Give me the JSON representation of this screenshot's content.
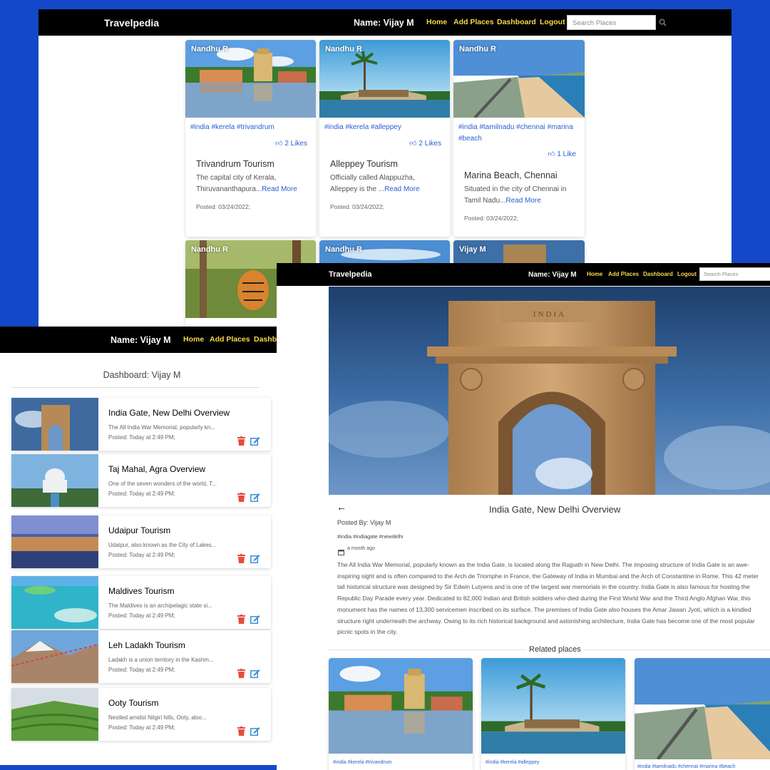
{
  "colors": {
    "background": "#1448c8",
    "navbar": "#000000",
    "nav_link": "#f5d84b",
    "link": "#2a5fd0",
    "delete": "#e74c3c",
    "edit": "#3a8fd9"
  },
  "nav": {
    "brand": "Travelpedia",
    "user": "Name: Vijay M",
    "links": [
      "Home",
      "Add Places",
      "Dashboard",
      "Logout"
    ],
    "search_placeholder": "Search Places",
    "search_icon": "search-icon"
  },
  "feed": {
    "cards": [
      {
        "author": "Nandhu R",
        "tags": "#india #kerela #trivandrum",
        "likes": "2 Likes",
        "title": "Trivandrum Tourism",
        "desc": "The capital city of Kerala, Thiruvananthapura...",
        "read_more": "Read More",
        "posted": "Posted: 03/24/2022;"
      },
      {
        "author": "Nandhu R",
        "tags": "#india #kerela #alleppey",
        "likes": "2 Likes",
        "title": "Alleppey Tourism",
        "desc": "Officially called Alappuzha, Alleppey is the ...",
        "read_more": "Read More",
        "posted": "Posted: 03/24/2022;"
      },
      {
        "author": "Nandhu R",
        "tags": "#india #tamilnadu #chennai #marina #beach",
        "likes": "1 Like",
        "title": "Marina Beach, Chennai",
        "desc": "Situated in the city of Chennai in Tamil Nadu...",
        "read_more": "Read More",
        "posted": "Posted: 03/24/2022;"
      },
      {
        "author": "Nandhu R"
      },
      {
        "author": "Nandhu R"
      },
      {
        "author": "Vijay M"
      }
    ]
  },
  "dashboard": {
    "heading": "Dashboard: Vijay M",
    "items": [
      {
        "title": "India Gate, New Delhi Overview",
        "desc": "The All India War Memorial, popularly kn...",
        "posted": "Posted: Today at 2:49 PM;"
      },
      {
        "title": "Taj Mahal, Agra Overview",
        "desc": "One of the seven wonders of the world, T...",
        "posted": "Posted: Today at 2:49 PM;"
      },
      {
        "title": "Udaipur Tourism",
        "desc": "Udaipur, also known as the City of Lakes...",
        "posted": "Posted: Today at 2:49 PM;"
      },
      {
        "title": "Maldives Tourism",
        "desc": "The Maldives is an archipelagic state si...",
        "posted": "Posted: Today at 2:49 PM;"
      },
      {
        "title": "Leh Ladakh Tourism",
        "desc": "Ladakh is a union territory in the Kashm...",
        "posted": "Posted: Today at 2:49 PM;"
      },
      {
        "title": "Ooty Tourism",
        "desc": "Nestled amidst Nilgiri hills, Ooty, also...",
        "posted": "Posted: Today at 2:49 PM;"
      }
    ]
  },
  "detail": {
    "title": "India Gate, New Delhi Overview",
    "posted_by": "Posted By: Vijay M",
    "tags": "#india #indiagate #newdelhi",
    "time": "a month ago",
    "monument_inscription": "INDIA",
    "body": "The All India War Memorial, popularly known as the India Gate, is located along the Rajpath in New Delhi. The imposing structure of India Gate is an awe-inspiring sight and is often compared to the Arch de Triomphe in France, the Gateway of India in Mumbai and the Arch of Constantine in Rome. This 42 meter tall historical structure was designed by Sir Edwin Lutyens and is one of the largest war memorials in the country. India Gate is also famous for hosting the Republic Day Parade every year. Dedicated to 82,000 Indian and British soldiers who died during the First World War and the Third Anglo Afghan War, this monument has the names of 13,300 servicemen inscribed on its surface. The premises of India Gate also houses the Amar Jawan Jyoti, which is a kindled structure right underneath the archway. Owing to its rich historical background and astonishing architecture, India Gate has become one of the most popular picnic spots in the city.",
    "related_heading": "Related places",
    "related": [
      {
        "tags": "#india #kerela #trivandrum"
      },
      {
        "tags": "#india #kerela #alleppey"
      },
      {
        "tags": "#india #tamilnadu #chennai #marina #beach"
      }
    ]
  }
}
